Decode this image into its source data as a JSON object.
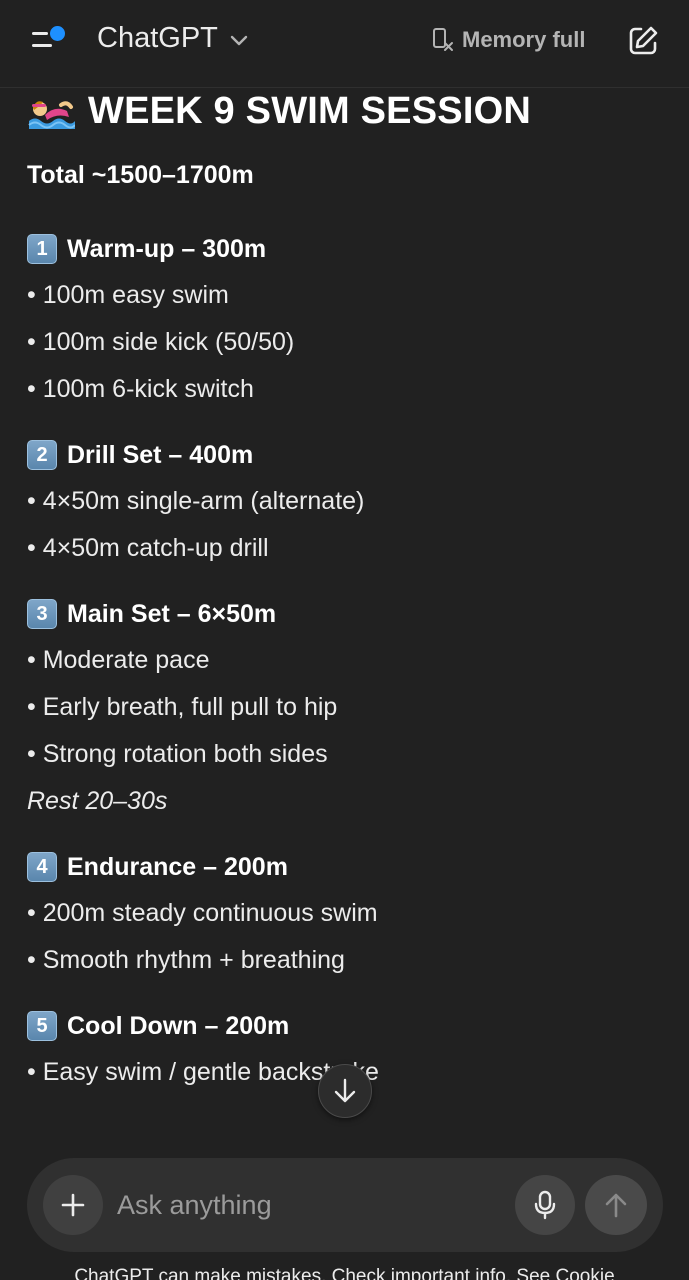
{
  "header": {
    "model_name": "ChatGPT",
    "memory_label": "Memory full"
  },
  "message": {
    "title": "WEEK 9 SWIM SESSION",
    "total": "Total ~1500–1700m",
    "sections": [
      {
        "number": "1",
        "title": "Warm-up – 300m",
        "bullets": [
          "• 100m easy swim",
          "• 100m side kick (50/50)",
          "• 100m 6-kick switch"
        ]
      },
      {
        "number": "2",
        "title": "Drill Set – 400m",
        "bullets": [
          "• 4×50m single-arm (alternate)",
          "• 4×50m catch-up drill"
        ]
      },
      {
        "number": "3",
        "title": "Main Set – 6×50m",
        "bullets": [
          "• Moderate pace",
          "• Early breath, full pull to hip",
          "• Strong rotation both sides"
        ],
        "note": "Rest 20–30s"
      },
      {
        "number": "4",
        "title": "Endurance – 200m",
        "bullets": [
          "• 200m steady continuous swim",
          "• Smooth rhythm + breathing"
        ]
      },
      {
        "number": "5",
        "title": "Cool Down – 200m",
        "bullets": [
          "• Easy swim / gentle backstroke"
        ]
      }
    ]
  },
  "composer": {
    "placeholder": "Ask anything"
  },
  "footer": {
    "disclaimer": "ChatGPT can make mistakes. Check important info. See Cookie"
  },
  "icons": {
    "menu": "menu-icon",
    "notification_dot": "blue-dot",
    "model_dropdown": "chevron-down-icon",
    "memory": "memory-full-icon",
    "new_chat": "edit-icon",
    "swimmer": "swimmer-emoji",
    "scroll_down": "arrow-down-icon",
    "plus": "plus-icon",
    "mic": "microphone-icon",
    "send": "arrow-up-icon"
  },
  "colors": {
    "background": "#212121",
    "composer": "#303030",
    "accent_dot": "#1e90ff",
    "keycap": "#6b95bb"
  }
}
